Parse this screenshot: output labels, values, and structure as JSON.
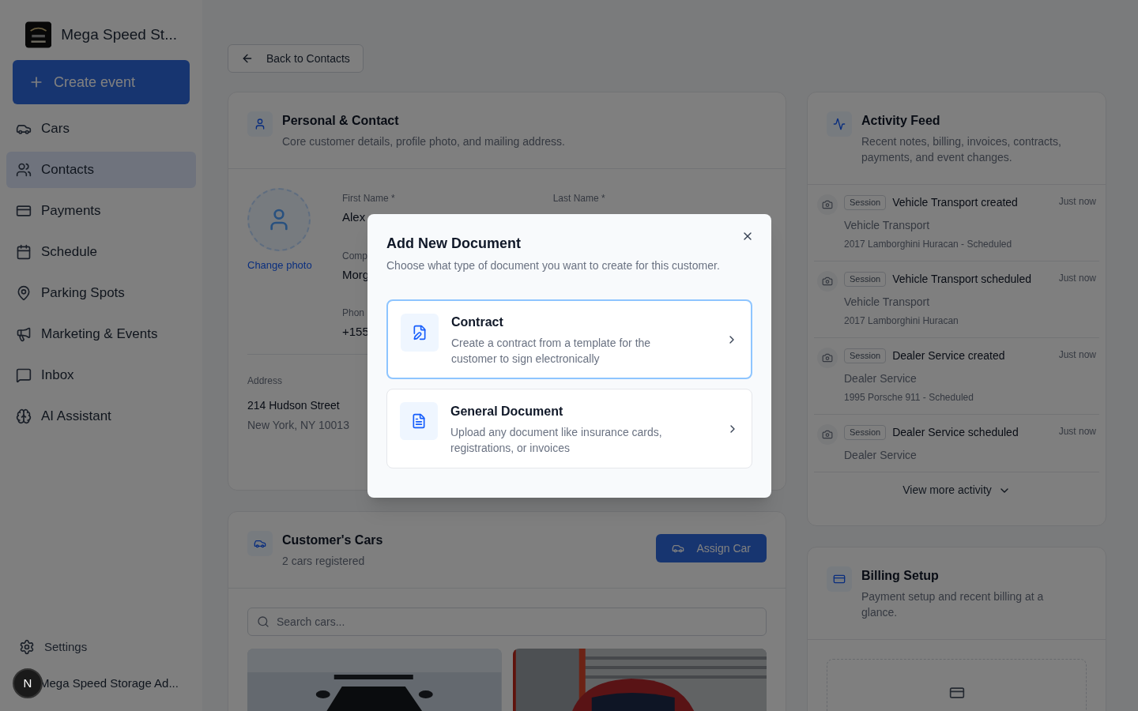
{
  "sidebar": {
    "brand": "Mega Speed St...",
    "create_button": "Create event",
    "items": [
      {
        "kind": "car",
        "label": "Cars",
        "selected": false
      },
      {
        "kind": "users",
        "label": "Contacts",
        "selected": true
      },
      {
        "kind": "card",
        "label": "Payments",
        "selected": false
      },
      {
        "kind": "calendar",
        "label": "Schedule",
        "selected": false
      },
      {
        "kind": "pin",
        "label": "Parking Spots",
        "selected": false
      },
      {
        "kind": "megaphone",
        "label": "Marketing & Events",
        "selected": false
      },
      {
        "kind": "message",
        "label": "Inbox",
        "selected": false
      },
      {
        "kind": "brain",
        "label": "AI Assistant",
        "selected": false
      }
    ],
    "settings": "Settings",
    "user": {
      "initial": "N",
      "name": "Mega Speed Storage Ad..."
    }
  },
  "back_button": "Back to Contacts",
  "personal": {
    "title": "Personal & Contact",
    "subtitle": "Core customer details, profile photo, and mailing address.",
    "change_photo": "Change photo",
    "fields": [
      {
        "label": "First Name *",
        "value": "Alex"
      },
      {
        "label": "Comp",
        "value": "Morg"
      },
      {
        "label": "Phon",
        "value": "+155"
      }
    ],
    "last_name_label": "Last Name *",
    "address_label": "Address",
    "address_lines": [
      "214 Hudson Street",
      "New York, NY 10013"
    ]
  },
  "cars": {
    "title": "Customer's Cars",
    "subtitle": "2 cars registered",
    "assign_button": "Assign Car",
    "search": {
      "placeholder": "Search cars..."
    }
  },
  "activity": {
    "title": "Activity Feed",
    "subtitle": "Recent notes, billing, invoices, contracts, payments, and event changes.",
    "items": [
      {
        "badge": "Session",
        "title": "Vehicle Transport created",
        "time": "Just now",
        "subtitle": "Vehicle Transport",
        "detail": "2017 Lamborghini Huracan - Scheduled"
      },
      {
        "badge": "Session",
        "title": "Vehicle Transport scheduled",
        "time": "Just now",
        "subtitle": "Vehicle Transport",
        "detail": "2017 Lamborghini Huracan"
      },
      {
        "badge": "Session",
        "title": "Dealer Service created",
        "time": "Just now",
        "subtitle": "Dealer Service",
        "detail": "1995 Porsche 911 - Scheduled"
      },
      {
        "badge": "Session",
        "title": "Dealer Service scheduled",
        "time": "Just now",
        "subtitle": "Dealer Service"
      }
    ],
    "view_more": "View more activity"
  },
  "billing": {
    "title": "Billing Setup",
    "subtitle": "Payment setup and recent billing at a glance."
  },
  "modal": {
    "title": "Add New Document",
    "subtitle": "Choose what type of document you want to create for this customer.",
    "options": [
      {
        "kind": "contract",
        "title": "Contract",
        "description": "Create a contract from a template for the customer to sign electronically",
        "selected": true
      },
      {
        "kind": "document",
        "title": "General Document",
        "description": "Upload any document like insurance cards, registrations, or invoices",
        "selected": false
      }
    ]
  }
}
